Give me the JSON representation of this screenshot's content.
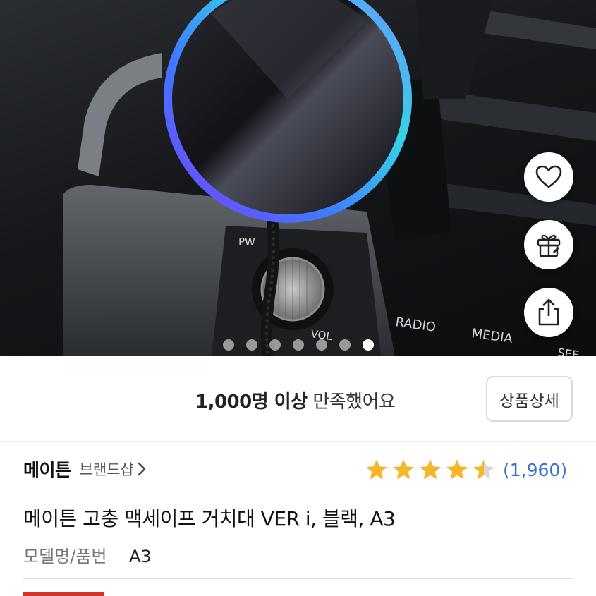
{
  "hero": {
    "image_name": "magsafe-car-mount-photo",
    "dash_labels": {
      "radio": "RADIO",
      "media": "MEDIA",
      "vol": "VOL",
      "pw": "PW",
      "seek": "SEE"
    },
    "carousel": {
      "count": 7,
      "active_index": 6
    },
    "actions": [
      "heart-icon",
      "gift-icon",
      "share-icon"
    ]
  },
  "satisfaction": {
    "count_text": "1,000명 이상",
    "suffix": "만족했어요",
    "detail_button": "상품상세"
  },
  "brand": {
    "name": "메이튼",
    "shop_link": "브랜드샵"
  },
  "rating": {
    "stars": 4.5,
    "count": "(1,960)",
    "star_color": "#f5b728"
  },
  "product": {
    "title": "메이튼 고충 맥세이프 거치대 VER i, 블랙, A3",
    "model_label": "모델명/품번",
    "model_value": "A3"
  },
  "colors": {
    "accent_blue": "#3c6fd1",
    "accent_red": "#d0342c"
  }
}
